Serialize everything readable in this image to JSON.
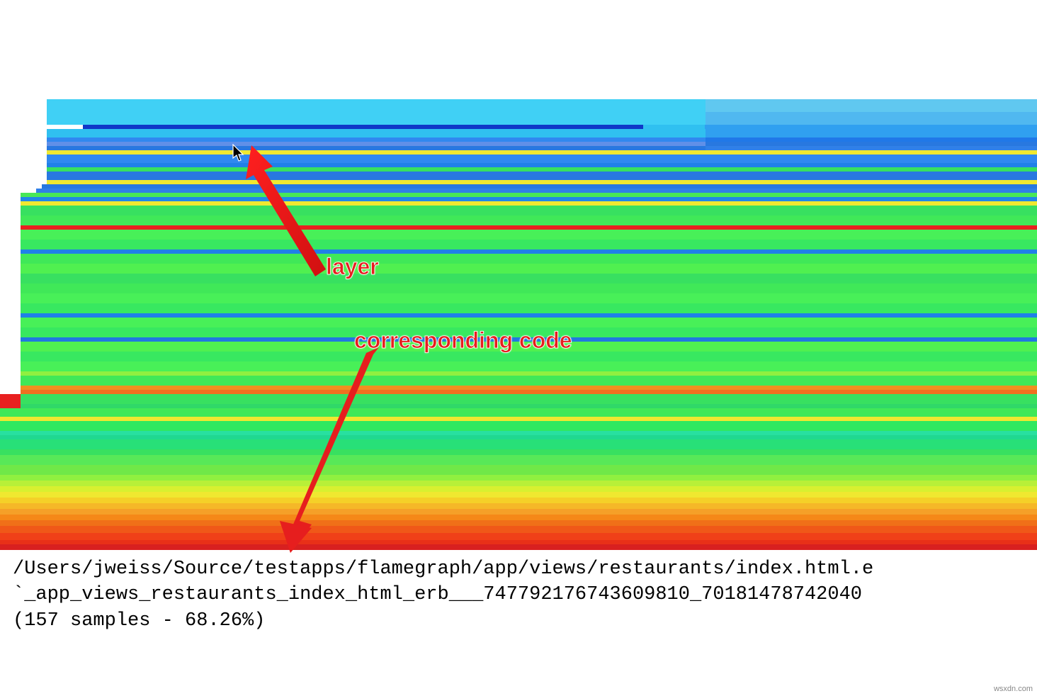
{
  "annotations": {
    "layer": "layer",
    "corresponding_code": "corresponding code"
  },
  "code": {
    "path": "/Users/jweiss/Source/testapps/flamegraph/app/views/restaurants/index.html.e",
    "method": "`_app_views_restaurants_index_html_erb___747792176743609810_70181478742040",
    "samples": "(157 samples - 68.26%)"
  },
  "watermark": "wsxdn.com",
  "colors": {
    "red": "#e61e1e",
    "green1": "#34e060",
    "green2": "#5df05e",
    "greenlight": "#a8f25a",
    "yellow": "#f0e850",
    "orange1": "#f5a030",
    "orange2": "#f57020",
    "orangered": "#f04020",
    "blue1": "#2080e8",
    "blue2": "#4090f0",
    "blue3": "#3050e0",
    "cyan1": "#20d0f0",
    "cyan2": "#60dff5",
    "purple": "#a030d8",
    "purple2": "#8040d0",
    "lime": "#78e050"
  }
}
